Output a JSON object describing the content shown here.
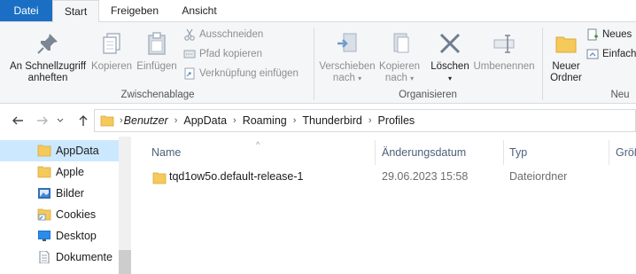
{
  "tabs": {
    "file": "Datei",
    "start": "Start",
    "share": "Freigeben",
    "view": "Ansicht"
  },
  "ribbon": {
    "clipboard": {
      "pin_line1": "An Schnellzugriff",
      "pin_line2": "anheften",
      "copy": "Kopieren",
      "paste": "Einfügen",
      "cut": "Ausschneiden",
      "copy_path": "Pfad kopieren",
      "paste_shortcut": "Verknüpfung einfügen",
      "group_label": "Zwischenablage"
    },
    "organize": {
      "move_line1": "Verschieben",
      "move_line2": "nach",
      "copyto_line1": "Kopieren",
      "copyto_line2": "nach",
      "delete": "Löschen",
      "rename": "Umbenennen",
      "group_label": "Organisieren"
    },
    "new": {
      "new_folder_line1": "Neuer",
      "new_folder_line2": "Ordner",
      "new_item": "Neues",
      "easy_access": "Einfach",
      "group_label": "Neu"
    }
  },
  "address": {
    "crumbs": [
      "Benutzer",
      "AppData",
      "Roaming",
      "Thunderbird",
      "Profiles"
    ]
  },
  "nav_pane": {
    "items": [
      {
        "label": "AppData",
        "icon": "folder-icon"
      },
      {
        "label": "Apple",
        "icon": "folder-icon"
      },
      {
        "label": "Bilder",
        "icon": "pictures-icon"
      },
      {
        "label": "Cookies",
        "icon": "cookies-folder-icon"
      },
      {
        "label": "Desktop",
        "icon": "desktop-icon"
      },
      {
        "label": "Dokumente",
        "icon": "documents-icon"
      }
    ]
  },
  "columns": {
    "name": "Name",
    "date": "Änderungsdatum",
    "type": "Typ",
    "size": "Größ"
  },
  "files": [
    {
      "name": "tqd1ow5o.default-release-1",
      "date": "29.06.2023 15:58",
      "type": "Dateiordner"
    }
  ],
  "colors": {
    "file_tab": "#1a6fc4",
    "selection": "#cce8ff",
    "folder": "#f5c95a"
  }
}
